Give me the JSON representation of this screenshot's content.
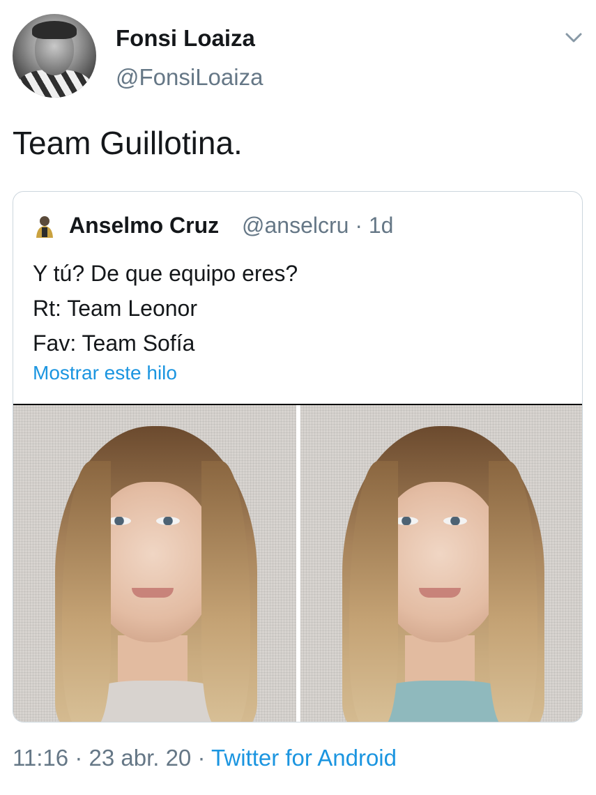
{
  "tweet": {
    "author": {
      "display_name": "Fonsi Loaiza",
      "handle": "@FonsiLoaiza",
      "avatar_icon": "user-avatar"
    },
    "menu_icon": "chevron-down-icon",
    "text": "Team Guillotina.",
    "quoted_tweet": {
      "author": {
        "display_name": "Anselmo Cruz",
        "handle": "@anselcru",
        "separator": "·",
        "age": "1d",
        "avatar_icon": "user-avatar"
      },
      "lines": [
        "Y tú? De que equipo eres?",
        "Rt: Team Leonor",
        "Fav: Team Sofía"
      ],
      "show_thread_label": "Mostrar este hilo",
      "photos": [
        {
          "name": "photo-left",
          "shirt_color": "#d8d3cf"
        },
        {
          "name": "photo-right",
          "shirt_color": "#8fb9bd"
        }
      ]
    },
    "footer": {
      "time": "11:16",
      "dot1": "·",
      "date": "23 abr. 20",
      "dot2": "·",
      "client": "Twitter for Android"
    }
  },
  "colors": {
    "text_primary": "#14171a",
    "text_secondary": "#657786",
    "link": "#1b95e0",
    "border": "#ccd6dd"
  }
}
